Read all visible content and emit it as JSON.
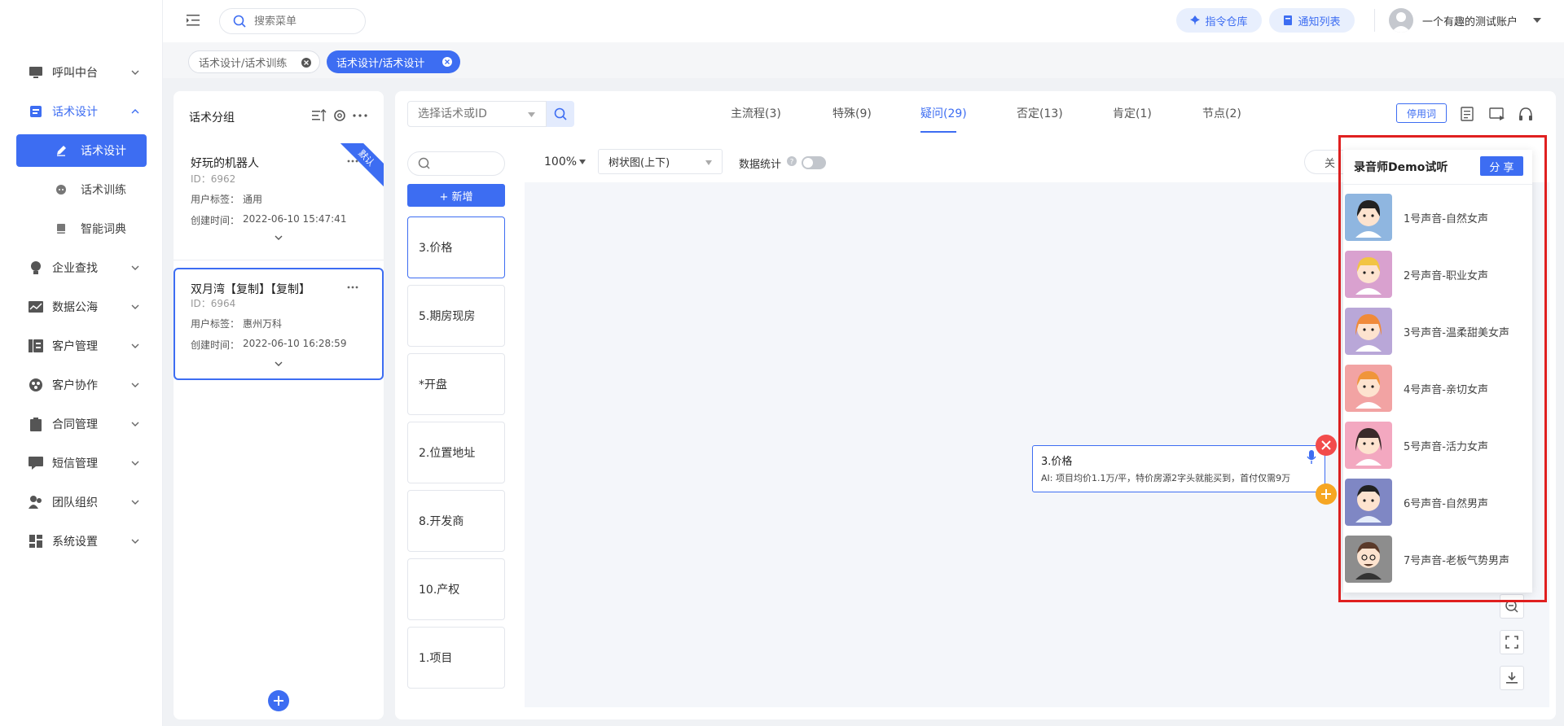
{
  "sidebar": {
    "items": [
      {
        "label": "呼叫中台",
        "icon": "monitor-icon"
      },
      {
        "label": "话术设计",
        "icon": "script-book-icon"
      },
      {
        "label": "企业查找",
        "icon": "lightbulb-icon"
      },
      {
        "label": "数据公海",
        "icon": "chart-line-icon"
      },
      {
        "label": "客户管理",
        "icon": "customer-card-icon"
      },
      {
        "label": "客户协作",
        "icon": "collaboration-icon"
      },
      {
        "label": "合同管理",
        "icon": "clipboard-icon"
      },
      {
        "label": "短信管理",
        "icon": "message-icon"
      },
      {
        "label": "团队组织",
        "icon": "team-icon"
      },
      {
        "label": "系统设置",
        "icon": "settings-grid-icon"
      }
    ],
    "submenu": [
      {
        "label": "话术设计",
        "icon": "edit-pen-icon"
      },
      {
        "label": "话术训练",
        "icon": "chat-bubble-icon"
      },
      {
        "label": "智能词典",
        "icon": "dictionary-icon"
      }
    ]
  },
  "topbar": {
    "search_placeholder": "搜索菜单",
    "btn_command": "指令仓库",
    "btn_notify": "通知列表",
    "username": "一个有趣的测试账户"
  },
  "open_tabs": [
    {
      "label": "话术设计/话术训练"
    },
    {
      "label": "话术设计/话术设计"
    }
  ],
  "groups": {
    "title": "话术分组",
    "cards": [
      {
        "name": "好玩的机器人",
        "id": "ID：6962",
        "tag_label": "用户标签：",
        "tag": "通用",
        "time_label": "创建时间：",
        "time": "2022-06-10 15:47:41",
        "ribbon": "默认"
      },
      {
        "name": "双月湾【复制】【复制】",
        "id": "ID：6964",
        "tag_label": "用户标签：",
        "tag": "惠州万科",
        "time_label": "创建时间：",
        "time": "2022-06-10 16:28:59"
      }
    ]
  },
  "editor": {
    "select_placeholder": "选择话术或ID",
    "tabs": [
      {
        "label": "主流程(3)"
      },
      {
        "label": "特殊(9)"
      },
      {
        "label": "疑问(29)"
      },
      {
        "label": "否定(13)"
      },
      {
        "label": "肯定(1)"
      },
      {
        "label": "节点(2)"
      }
    ],
    "disabled_words_btn": "停用词",
    "add_btn": "+ 新增",
    "questions": [
      "3.价格",
      "5.期房现房",
      "*开盘",
      "2.位置地址",
      "8.开发商",
      "10.产权",
      "1.项目"
    ],
    "zoom": "100%",
    "view_mode": "树状图(上下)",
    "stats_label": "数据统计",
    "close_btn_partial": "关",
    "node": {
      "title": "3.价格",
      "text": "AI: 项目均价1.1万/平，特价房源2字头就能买到，首付仅需9万"
    }
  },
  "voice_panel": {
    "title": "录音师Demo试听",
    "share_btn": "分 享",
    "voices": [
      {
        "label": "1号声音-自然女声",
        "bg": "#8fb6e0"
      },
      {
        "label": "2号声音-职业女声",
        "bg": "#d9a1cf"
      },
      {
        "label": "3号声音-温柔甜美女声",
        "bg": "#b9a7d8"
      },
      {
        "label": "4号声音-亲切女声",
        "bg": "#f2a3a3"
      },
      {
        "label": "5号声音-活力女声",
        "bg": "#f3a8c0"
      },
      {
        "label": "6号声音-自然男声",
        "bg": "#7f87c4"
      },
      {
        "label": "7号声音-老板气势男声",
        "bg": "#8d8d8d"
      }
    ]
  },
  "colors": {
    "primary": "#3d6df2",
    "highlight_border": "#e02020",
    "close_red": "#f24b4b",
    "add_orange": "#f6a623"
  }
}
